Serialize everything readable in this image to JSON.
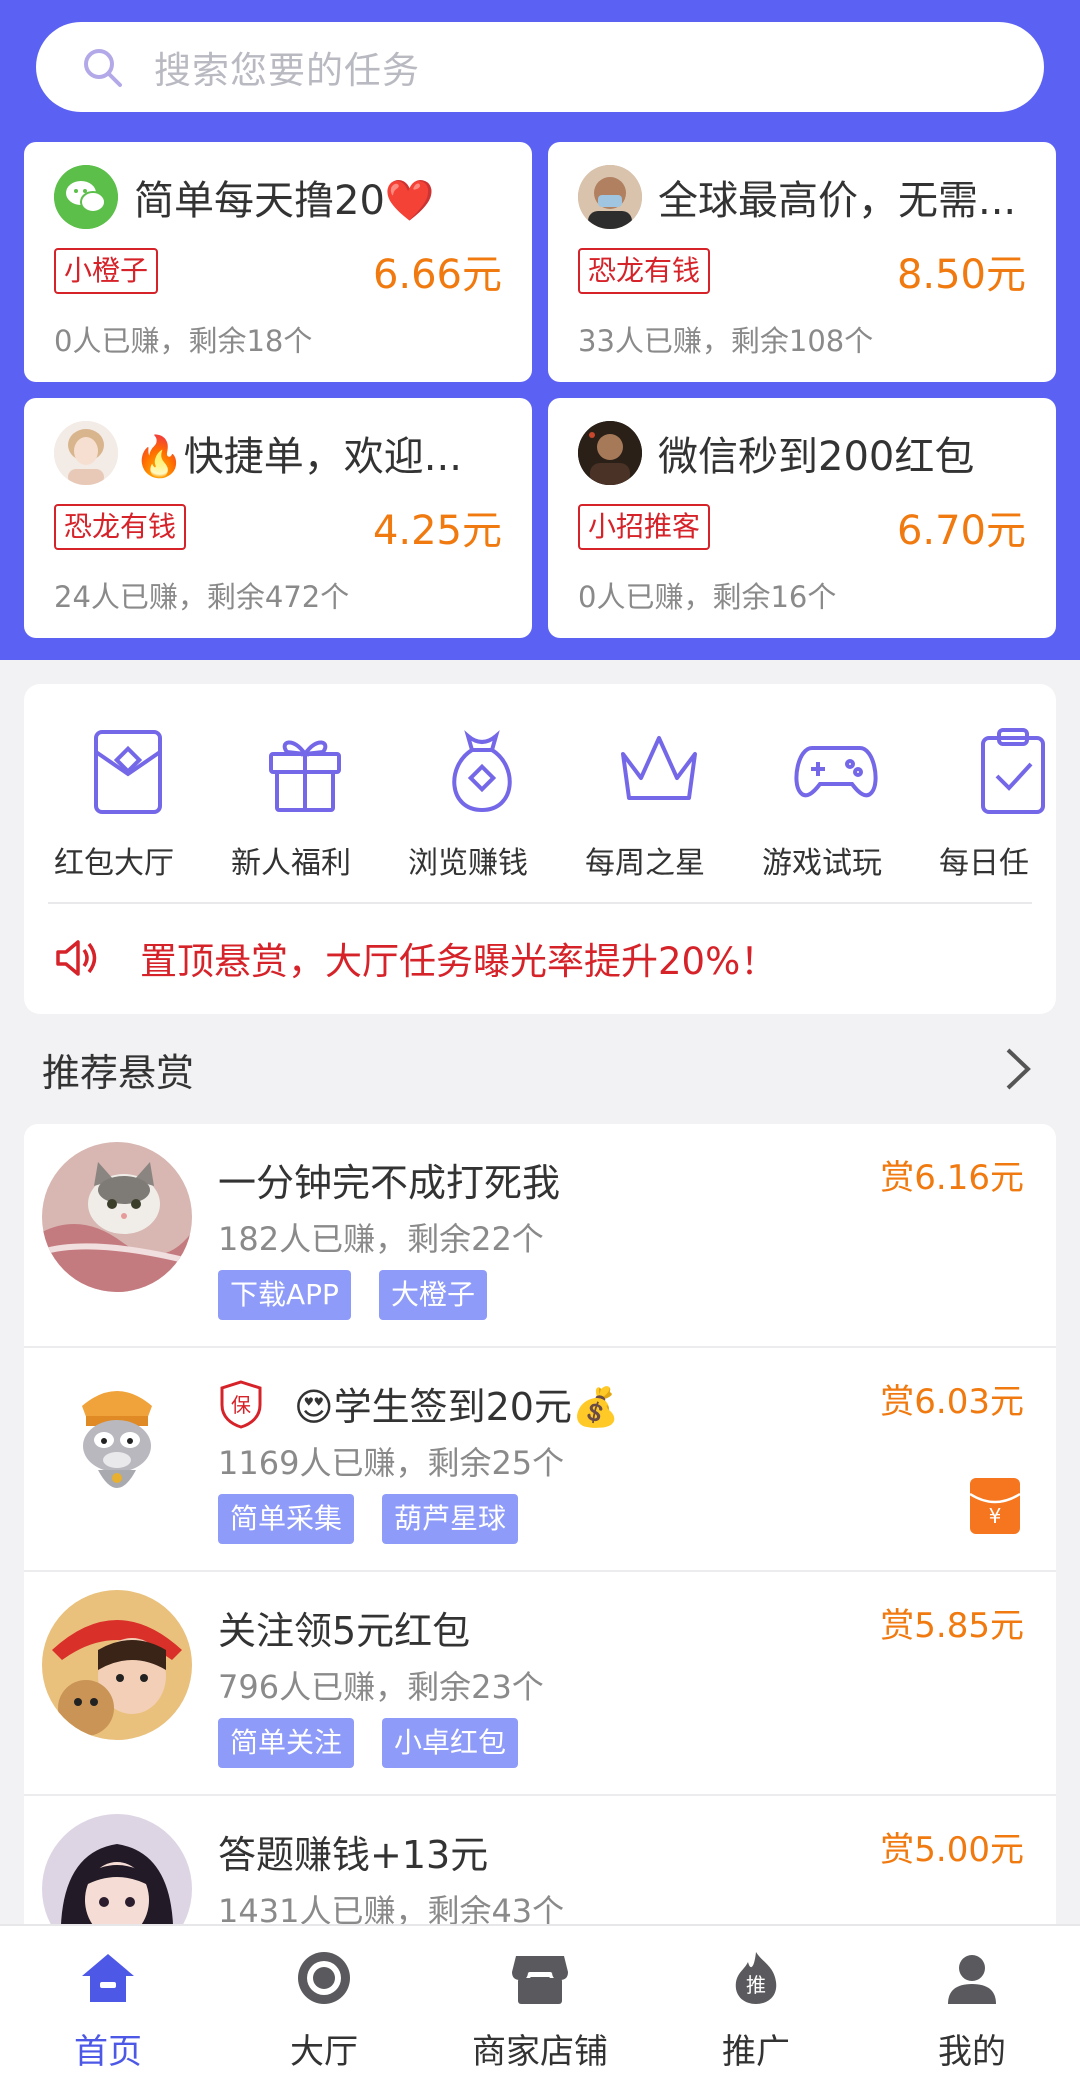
{
  "search": {
    "placeholder": "搜索您要的任务"
  },
  "featured": [
    {
      "title": "简单每天撸20❤️",
      "tag": "小橙子",
      "price": "6.66元",
      "stat": "0人已赚，剩余18个"
    },
    {
      "title": "全球最高价，无需...",
      "tag": "恐龙有钱",
      "price": "8.50元",
      "stat": "33人已赚，剩余108个"
    },
    {
      "title": "🔥快捷单，欢迎...",
      "tag": "恐龙有钱",
      "price": "4.25元",
      "stat": "24人已赚，剩余472个"
    },
    {
      "title": "微信秒到200红包",
      "tag": "小招推客",
      "price": "6.70元",
      "stat": "0人已赚，剩余16个"
    }
  ],
  "categories": [
    {
      "label": "红包大厅",
      "icon": "red-envelope-icon"
    },
    {
      "label": "新人福利",
      "icon": "gift-icon"
    },
    {
      "label": "浏览赚钱",
      "icon": "money-bag-icon"
    },
    {
      "label": "每周之星",
      "icon": "crown-icon"
    },
    {
      "label": "游戏试玩",
      "icon": "gamepad-icon"
    },
    {
      "label": "每日任",
      "icon": "clipboard-check-icon"
    }
  ],
  "notice": {
    "text": "置顶悬赏，大厅任务曝光率提升20%！"
  },
  "recommend": {
    "heading": "推荐悬赏",
    "items": [
      {
        "title": "一分钟完不成打死我",
        "stat": "182人已赚，剩余22个",
        "tags": [
          "下载APP",
          "大橙子"
        ],
        "price": "赏6.16元"
      },
      {
        "title": "😍学生签到20元💰",
        "stat": "1169人已赚，剩余25个",
        "tags": [
          "简单采集",
          "葫芦星球"
        ],
        "price": "赏6.03元",
        "guard": "保"
      },
      {
        "title": "关注领5元红包",
        "stat": "796人已赚，剩余23个",
        "tags": [
          "简单关注",
          "小卓红包"
        ],
        "price": "赏5.85元"
      },
      {
        "title": "答题赚钱+13元",
        "stat": "1431人已赚，剩余43个",
        "tags": [],
        "price": "赏5.00元"
      }
    ]
  },
  "nav": [
    {
      "label": "首页",
      "active": true
    },
    {
      "label": "大厅"
    },
    {
      "label": "商家店铺"
    },
    {
      "label": "推广",
      "badge": "推"
    },
    {
      "label": "我的"
    }
  ],
  "colors": {
    "brand": "#5b61f3",
    "price": "#f07a0f",
    "red": "#d6232a",
    "tagBlue": "#8e9bf8",
    "navActive": "#4d59e6"
  }
}
